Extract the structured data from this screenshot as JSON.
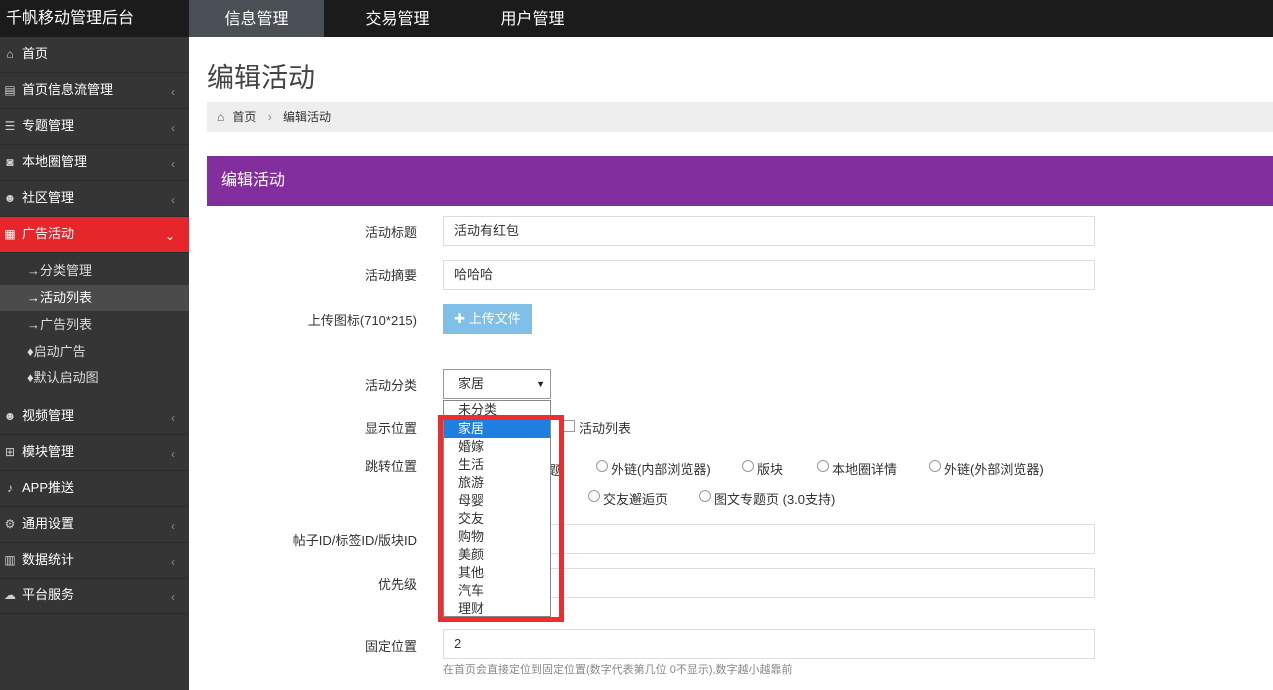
{
  "app": {
    "brand": "千帆移动管理后台"
  },
  "nav": {
    "tabs": [
      "信息管理",
      "交易管理",
      "用户管理"
    ]
  },
  "sidebar": {
    "items": [
      {
        "label": "首页",
        "icon": "home-icon"
      },
      {
        "label": "首页信息流管理",
        "icon": "file-icon"
      },
      {
        "label": "专题管理",
        "icon": "list-icon"
      },
      {
        "label": "本地圈管理",
        "icon": "camera-icon"
      },
      {
        "label": "社区管理",
        "icon": "users-icon"
      },
      {
        "label": "广告活动",
        "icon": "calendar-icon"
      },
      {
        "label": "视频管理",
        "icon": "users-icon"
      },
      {
        "label": "模块管理",
        "icon": "sitemap-icon"
      },
      {
        "label": "APP推送",
        "icon": "bell-icon"
      },
      {
        "label": "通用设置",
        "icon": "cogs-icon"
      },
      {
        "label": "数据统计",
        "icon": "bar-chart-icon"
      },
      {
        "label": "平台服务",
        "icon": "cloud-icon"
      }
    ],
    "sub_items": [
      "→分类管理",
      "→活动列表",
      "→广告列表",
      "启动广告",
      "默认启动图"
    ]
  },
  "page": {
    "title": "编辑活动"
  },
  "breadcrumb": {
    "home": "首页",
    "current": "编辑活动"
  },
  "panel": {
    "title": "编辑活动"
  },
  "form": {
    "title_label": "活动标题",
    "title_value": "活动有红包",
    "summary_label": "活动摘要",
    "summary_value": "哈哈哈",
    "icon_label": "上传图标(710*215)",
    "upload_label": "✚ 上传文件",
    "category_label": "活动分类",
    "category_value": "家居",
    "category_options": [
      "未分类",
      "家居",
      "婚嫁",
      "生活",
      "旅游",
      "母婴",
      "交友",
      "购物",
      "美颜",
      "其他",
      "汽车",
      "理财"
    ],
    "display_label": "显示位置",
    "display_option": "活动列表",
    "jump_label": "跳转位置",
    "jump_row1": [
      "题",
      "外链(内部浏览器)",
      "版块",
      "本地圈详情",
      "外链(外部浏览器)"
    ],
    "jump_row2": [
      "交友邂逅页",
      "图文专题页 (3.0支持)"
    ],
    "post_id_label": "帖子ID/标签ID/版块ID",
    "priority_label": "优先级",
    "fixed_label": "固定位置",
    "fixed_value": "2",
    "fixed_hint": "在首页会直接定位到固定位置(数字代表第几位 0不显示),数字越小越靠前"
  }
}
